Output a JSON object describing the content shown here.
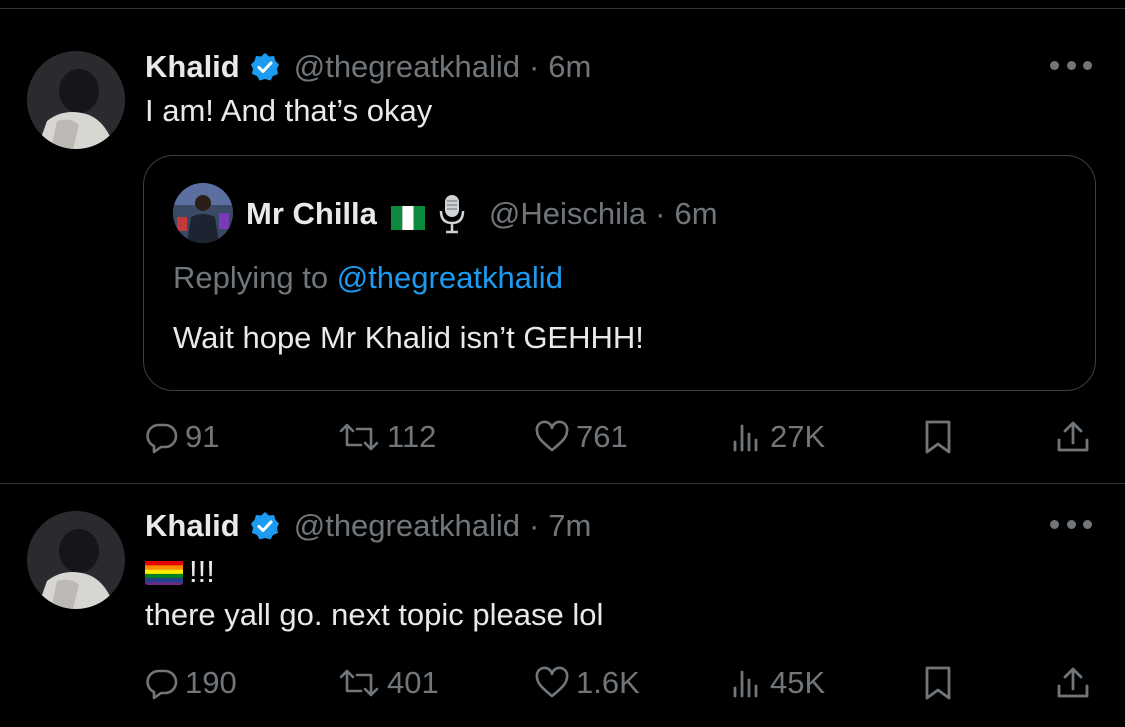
{
  "tweets": [
    {
      "name": "Khalid",
      "handle": "@thegreatkhalid",
      "separator": "·",
      "time": "6m",
      "text": "I am! And that’s okay",
      "quote": {
        "name": "Mr Chilla",
        "handle": "@Heischila",
        "separator": "·",
        "time": "6m",
        "replying_prefix": "Replying to ",
        "replying_to": "@thegreatkhalid",
        "text": "Wait hope Mr Khalid isn’t GEHHH!"
      },
      "stats": {
        "replies": "91",
        "reposts": "112",
        "likes": "761",
        "views": "27K"
      }
    },
    {
      "name": "Khalid",
      "handle": "@thegreatkhalid",
      "separator": "·",
      "time": "7m",
      "line1": "!!!",
      "line2": "there yall go. next topic please lol",
      "stats": {
        "replies": "190",
        "reposts": "401",
        "likes": "1.6K",
        "views": "45K"
      }
    }
  ],
  "icons": {
    "verified": "verified-badge-icon",
    "more": "more-options-icon",
    "reply": "reply-icon",
    "repost": "repost-icon",
    "like": "heart-icon",
    "views": "views-icon",
    "bookmark": "bookmark-icon",
    "share": "share-icon",
    "flag": "nigeria-flag-icon",
    "mic": "microphone-icon",
    "rainbow": "rainbow-flag-icon"
  },
  "colors": {
    "background": "#000000",
    "text": "#e7e9ea",
    "muted": "#71767b",
    "accent": "#1d9bf0",
    "border": "#2f3336"
  }
}
